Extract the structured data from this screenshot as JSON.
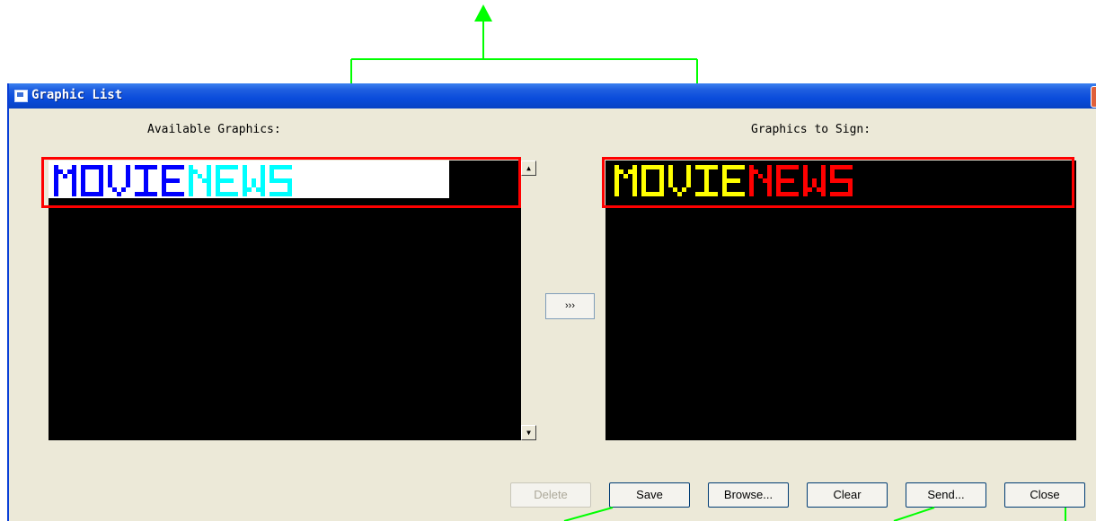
{
  "window": {
    "title": "Graphic List"
  },
  "available": {
    "label": "Available Graphics:",
    "item_text_part1": "MOVIE",
    "item_text_part2": "NEWS",
    "color_part1": "#0000ff",
    "color_part2": "#00ffff",
    "background": "#ffffff"
  },
  "to_sign": {
    "label": "Graphics to Sign:",
    "item_text_part1": "MOVIE",
    "item_text_part2": "NEWS",
    "color_part1": "#ffff00",
    "color_part2": "#ff0000"
  },
  "move_button": {
    "label": "›››"
  },
  "buttons": {
    "delete": "Delete",
    "save": "Save",
    "browse": "Browse...",
    "clear": "Clear",
    "send": "Send...",
    "close": "Close"
  },
  "annotation_color": "#00ff00"
}
